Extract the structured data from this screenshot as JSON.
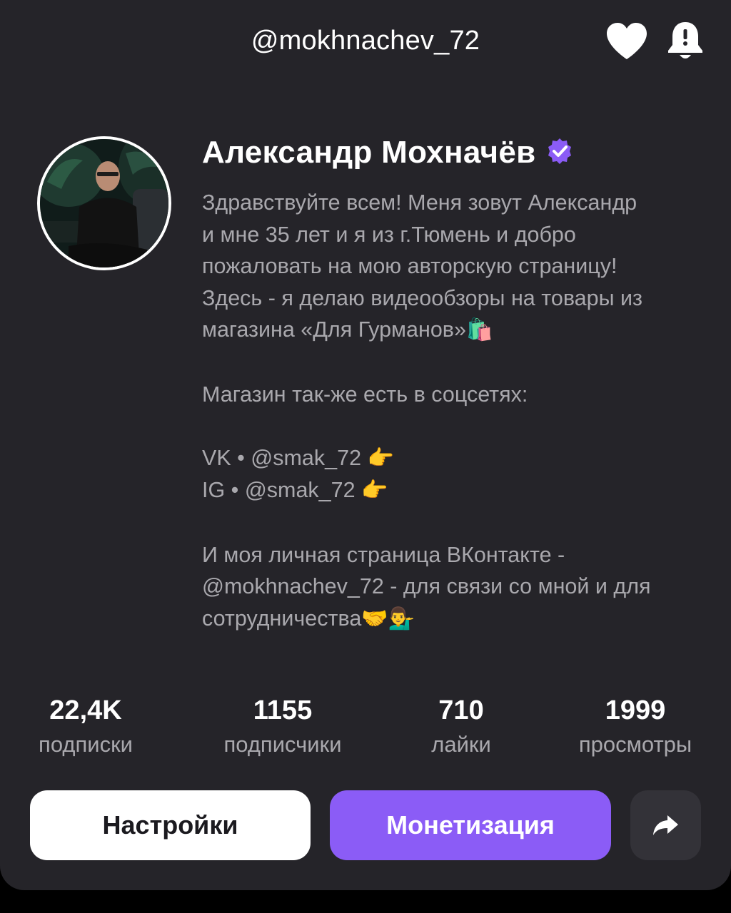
{
  "header": {
    "handle": "@mokhnachev_72",
    "like_icon": "heart-icon",
    "notify_icon": "bell-icon"
  },
  "profile": {
    "name": "Александр Мохначёв",
    "verified_icon": "verified-badge-icon",
    "accent_color": "#8b5cf6",
    "bio": {
      "line1": "Здравствуйте всем! Меня зовут Александр",
      "line2": "и мне 35 лет и я из г.Тюмень и добро",
      "line3": "пожаловать на мою авторскую страницу!",
      "line4": "Здесь - я делаю видеообзоры на товары из",
      "line5": "магазина «Для Гурманов»",
      "line5_emoji": "🛍️",
      "line6": "Магазин так-же есть в соцсетях:",
      "line7": "VK • @smak_72",
      "line7_emoji": "👉",
      "line8": "IG • @smak_72",
      "line8_emoji": "👉",
      "line9": "И моя личная страница ВКонтакте -",
      "line10": "@mokhnachev_72 - для связи со мной и для",
      "line11": "сотрудничества",
      "line11_emoji": "🤝💁‍♂️"
    }
  },
  "stats": [
    {
      "value": "22,4K",
      "label": "подписки"
    },
    {
      "value": "1155",
      "label": "подписчики"
    },
    {
      "value": "710",
      "label": "лайки"
    },
    {
      "value": "1999",
      "label": "просмотры"
    }
  ],
  "actions": {
    "settings_label": "Настройки",
    "monetization_label": "Монетизация",
    "share_icon": "share-arrow-icon"
  }
}
